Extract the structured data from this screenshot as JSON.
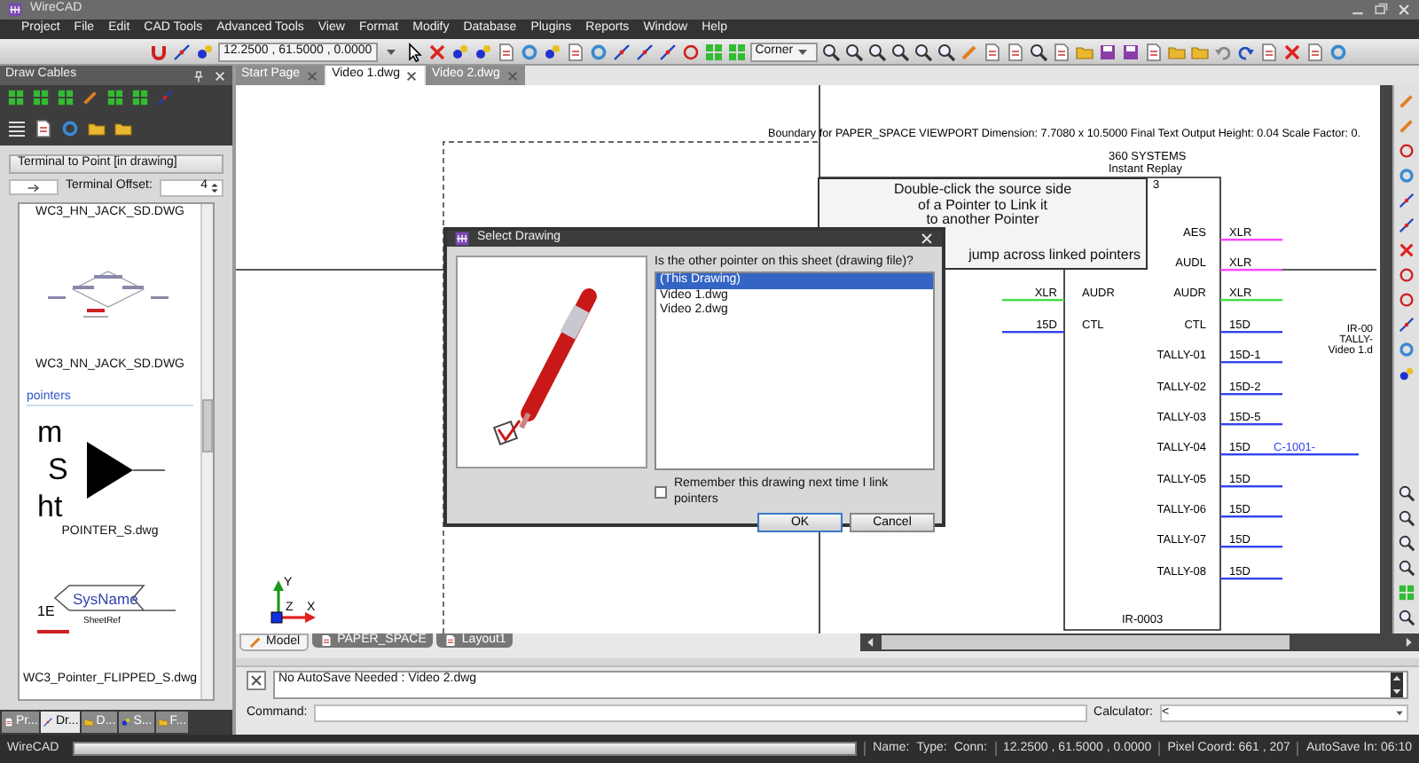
{
  "window": {
    "title": "WireCAD"
  },
  "menu": [
    "Project",
    "File",
    "Edit",
    "CAD Tools",
    "Advanced Tools",
    "View",
    "Format",
    "Modify",
    "Database",
    "Plugins",
    "Reports",
    "Window",
    "Help"
  ],
  "toolbar": {
    "coordinates": "12.2500 , 61.5000 , 0.0000",
    "snap_mode": "Corner"
  },
  "left_panel": {
    "title": "Draw Cables",
    "group_title": "Terminal to Point [in drawing]",
    "offset_label": "Terminal Offset:",
    "offset_value": "4",
    "symbols": [
      {
        "kind": "symbol",
        "caption": "WC3_HN_JACK_SD.DWG"
      },
      {
        "kind": "jack_symbol",
        "caption": "WC3_NN_JACK_SD.DWG"
      },
      {
        "kind": "header",
        "label": "pointers"
      },
      {
        "kind": "pointer_symbol",
        "texts": [
          "m",
          "S",
          "ht"
        ],
        "caption": "POINTER_S.dwg"
      },
      {
        "kind": "flipped_pointer_symbol",
        "texts": [
          "1E",
          "SysName",
          "SheetRef"
        ],
        "caption": "WC3_Pointer_FLIPPED_S.dwg"
      }
    ],
    "bottom_tabs": [
      {
        "label": "Pr...",
        "selected": false
      },
      {
        "label": "Dr...",
        "selected": true
      },
      {
        "label": "D...",
        "selected": false
      },
      {
        "label": "S...",
        "selected": false
      },
      {
        "label": "F...",
        "selected": false
      }
    ]
  },
  "document_tabs": [
    {
      "label": "Start Page",
      "selected": false
    },
    {
      "label": "Video 1.dwg",
      "selected": true
    },
    {
      "label": "Video 2.dwg",
      "selected": false
    }
  ],
  "drawing": {
    "boundary_note": "Boundary for PAPER_SPACE VIEWPORT Dimension: 7.7080 x 10.5000 Final Text Output Height: 0.04  Scale Factor: 0.",
    "device": {
      "maker": "360 SYSTEMS",
      "model": "Instant Replay",
      "partial_label": "3",
      "name": "IR-0003",
      "left_ports": [
        {
          "label": "AUDR",
          "cable": "XLR",
          "color": "#44dd44"
        },
        {
          "label": "CTL",
          "cable": "15D",
          "color": "#3344ee"
        }
      ],
      "right_ports": [
        {
          "label": "AES",
          "cable": "XLR",
          "color": "#ff44ff"
        },
        {
          "label": "AUDL",
          "cable": "XLR",
          "color": "#ff44ff"
        },
        {
          "label": "AUDR",
          "cable": "XLR",
          "color": "#44dd44"
        },
        {
          "label": "CTL",
          "cable": "15D",
          "color": "#3344ee"
        },
        {
          "label": "TALLY-01",
          "cable": "15D-1",
          "color": "#3344ee"
        },
        {
          "label": "TALLY-02",
          "cable": "15D-2",
          "color": "#3344ee"
        },
        {
          "label": "TALLY-03",
          "cable": "15D-5",
          "color": "#3344ee"
        },
        {
          "label": "TALLY-04",
          "cable": "15D",
          "color": "#3344ee",
          "link": "C-1001-"
        },
        {
          "label": "TALLY-05",
          "cable": "15D",
          "color": "#3344ee"
        },
        {
          "label": "TALLY-06",
          "cable": "15D",
          "color": "#3344ee"
        },
        {
          "label": "TALLY-07",
          "cable": "15D",
          "color": "#3344ee"
        },
        {
          "label": "TALLY-08",
          "cable": "15D",
          "color": "#3344ee"
        }
      ]
    },
    "offpage_labels": [
      "IR-00",
      "TALLY-",
      "Video 1.d"
    ],
    "axes": {
      "x": "X",
      "y": "Y",
      "z": "Z"
    }
  },
  "tooltip": {
    "lines": [
      "Double-click the source side",
      "of a Pointer to Link it",
      "to another Pointer"
    ],
    "tail": "jump across linked pointers"
  },
  "dialog": {
    "title": "Select Drawing",
    "prompt": "Is the other pointer on this sheet (drawing file)?",
    "options": [
      {
        "label": "(This Drawing)",
        "selected": true
      },
      {
        "label": "Video 1.dwg",
        "selected": false
      },
      {
        "label": "Video 2.dwg",
        "selected": false
      }
    ],
    "remember": {
      "label": "Remember this drawing next time I link pointers",
      "checked": false
    },
    "buttons": [
      "OK",
      "Cancel"
    ]
  },
  "layout_tabs": [
    {
      "label": "Model",
      "selected": true
    },
    {
      "label": "PAPER_SPACE",
      "selected": false
    },
    {
      "label": "Layout1",
      "selected": false
    }
  ],
  "command_area": {
    "message": "No AutoSave Needed : Video 2.dwg",
    "command_label": "Command:",
    "calculator_label": "Calculator:",
    "calculator_value": "<"
  },
  "status_bar": {
    "app": "WireCAD",
    "name_label": "Name:",
    "type_label": "Type:",
    "conn_label": "Conn:",
    "coordinates": "12.2500 , 61.5000 , 0.0000",
    "pixel_coord": "Pixel Coord: 661 , 207",
    "autosave": "AutoSave In: 06:10"
  }
}
